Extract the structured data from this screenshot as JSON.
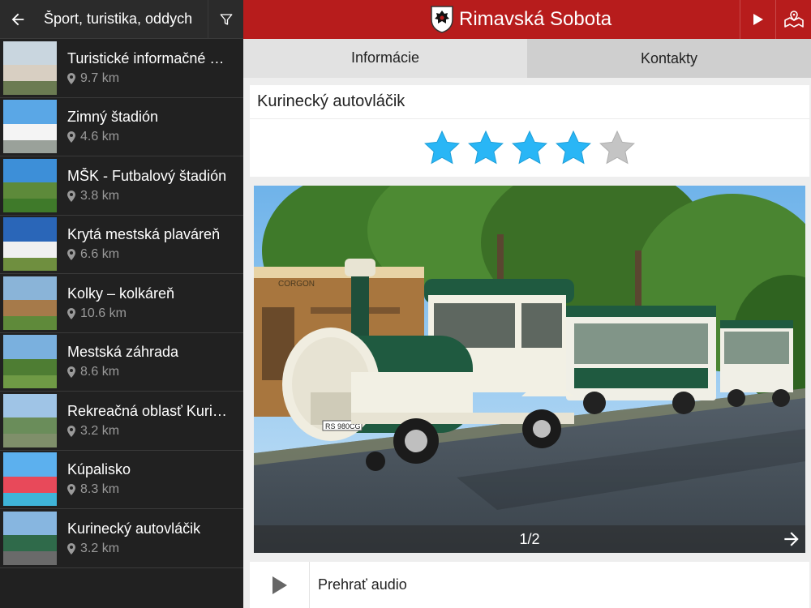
{
  "sidebar": {
    "title": "Šport, turistika, oddych",
    "items": [
      {
        "name": "Turistické informačné centrum",
        "distance": "9.7 km",
        "thumb": [
          "#c9d6df",
          "#d8cfc2",
          "#6b7b52"
        ]
      },
      {
        "name": "Zimný štadión",
        "distance": "4.6 km",
        "thumb": [
          "#5aa7e6",
          "#f4f4f4",
          "#9aa19a"
        ]
      },
      {
        "name": "MŠK - Futbalový štadión",
        "distance": "3.8 km",
        "thumb": [
          "#3d8fd8",
          "#5d8a3a",
          "#3f7a2a"
        ]
      },
      {
        "name": "Krytá mestská plaváreň",
        "distance": "6.6 km",
        "thumb": [
          "#2a66b8",
          "#f0f0f0",
          "#6f8f3f"
        ]
      },
      {
        "name": "Kolky – kolkáreň",
        "distance": "10.6 km",
        "thumb": [
          "#8ab4d8",
          "#a67a4a",
          "#5f8a3a"
        ]
      },
      {
        "name": "Mestská záhrada",
        "distance": "8.6 km",
        "thumb": [
          "#7ab0de",
          "#4e7d33",
          "#6f9a45"
        ]
      },
      {
        "name": "Rekreačná oblasť Kurinec",
        "distance": "3.2 km",
        "thumb": [
          "#9fc4e6",
          "#6a8d5a",
          "#7f8f6a"
        ]
      },
      {
        "name": "Kúpalisko",
        "distance": "8.3 km",
        "thumb": [
          "#5cb0ee",
          "#e8495a",
          "#3fb4d8"
        ]
      },
      {
        "name": "Kurinecký autovláčik",
        "distance": "3.2 km",
        "thumb": [
          "#87b6e0",
          "#2f6a4a",
          "#6a6a6a"
        ]
      }
    ]
  },
  "header": {
    "title": "Rimavská Sobota"
  },
  "tabs": {
    "info": "Informácie",
    "contacts": "Kontakty"
  },
  "detail": {
    "title": "Kurinecký autovláčik",
    "rating": 4,
    "max_rating": 5,
    "gallery_counter": "1/2",
    "train_plate": "RS 980CG",
    "sign_text": "CORGON",
    "audio_label": "Prehrať audio"
  },
  "colors": {
    "header_red": "#b71c1c",
    "star_active": "#29b6f6",
    "star_inactive": "#c4c4c4",
    "sidebar_bg": "#212121"
  },
  "icons": {
    "back": "arrow-left-icon",
    "filter": "filter-icon",
    "pin": "map-pin-icon",
    "play": "play-icon",
    "map": "map-icon",
    "next": "arrow-right-icon",
    "coat": "coat-of-arms-icon",
    "star": "star-icon"
  }
}
